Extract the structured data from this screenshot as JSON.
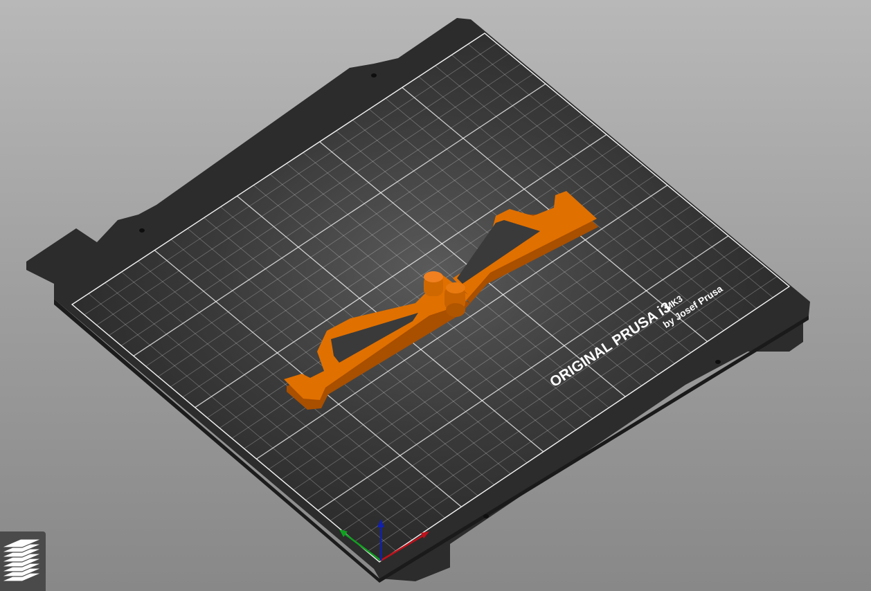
{
  "app": "PrusaSlicer",
  "view": "3D plater",
  "bed": {
    "label_main": "ORIGINAL PRUSA i3",
    "label_model": "MK3",
    "label_by": "by Josef Prusa",
    "color": "#2e2e2e",
    "grid_color": "#ffffff"
  },
  "model": {
    "color": "#e07000",
    "shade_color": "#a84f00"
  },
  "axes": {
    "x_color": "#c0101a",
    "y_color": "#10a020",
    "z_color": "#1020b0"
  },
  "toolbar": {
    "layers_icon": "layers-icon"
  }
}
